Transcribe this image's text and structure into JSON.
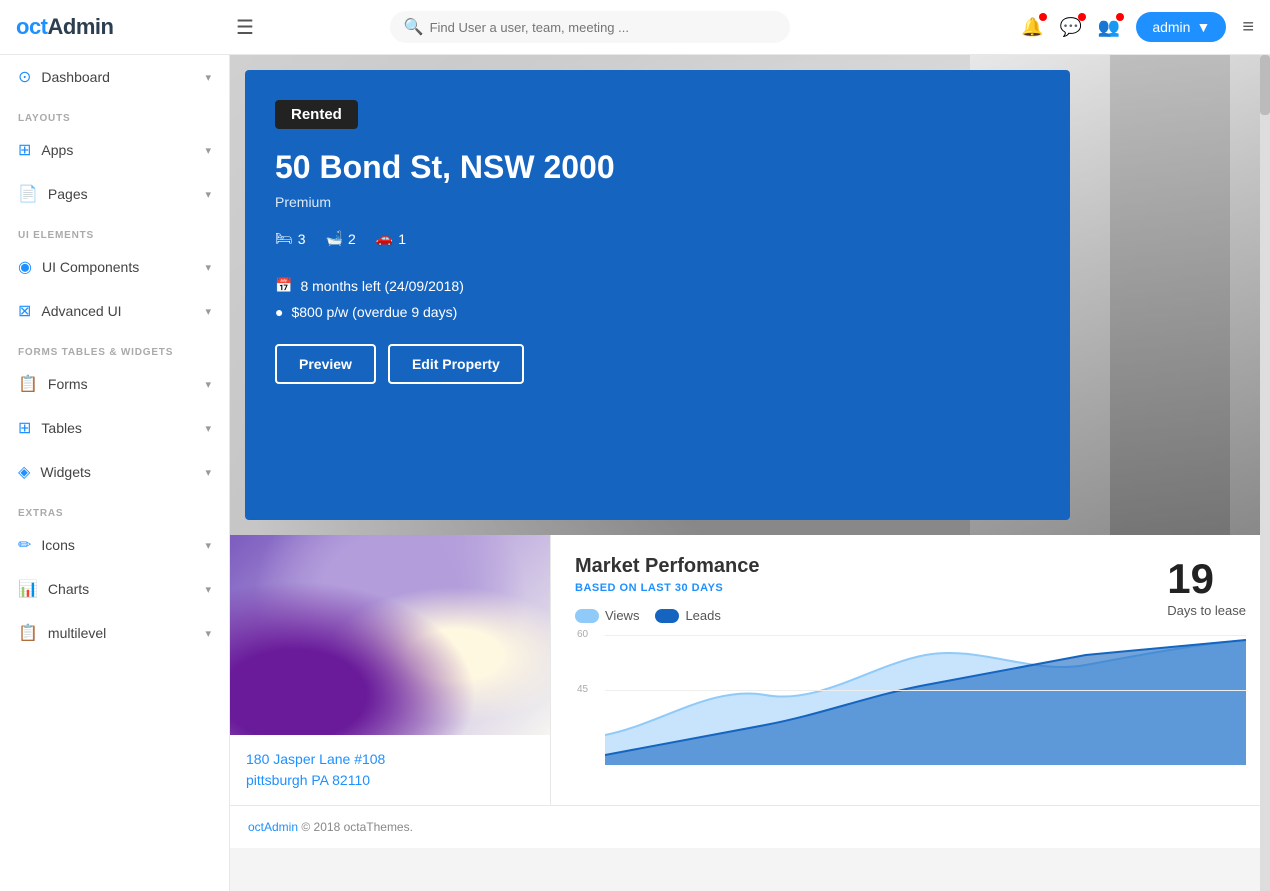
{
  "app": {
    "logo": "octAdmin",
    "logo_color": "oct",
    "logo_rest": "Admin"
  },
  "topnav": {
    "hamburger_icon": "☰",
    "search_placeholder": "Find User a user, team, meeting ...",
    "admin_label": "admin",
    "menu_icon": "≡"
  },
  "sidebar": {
    "items": [
      {
        "id": "dashboard",
        "label": "Dashboard",
        "icon": "⊙",
        "has_arrow": true
      },
      {
        "id": "apps",
        "label": "Apps",
        "icon": "⊞",
        "has_arrow": true
      },
      {
        "id": "pages",
        "label": "Pages",
        "icon": "📄",
        "has_arrow": true
      },
      {
        "id": "ui-components",
        "label": "UI Components",
        "icon": "◉",
        "has_arrow": true
      },
      {
        "id": "advanced-ui",
        "label": "Advanced UI",
        "icon": "⊠",
        "has_arrow": true
      },
      {
        "id": "forms",
        "label": "Forms",
        "icon": "📋",
        "has_arrow": true
      },
      {
        "id": "tables",
        "label": "Tables",
        "icon": "⊞",
        "has_arrow": true
      },
      {
        "id": "widgets",
        "label": "Widgets",
        "icon": "◈",
        "has_arrow": true
      },
      {
        "id": "icons",
        "label": "Icons",
        "icon": "✏",
        "has_arrow": true
      },
      {
        "id": "charts",
        "label": "Charts",
        "icon": "📊",
        "has_arrow": true
      },
      {
        "id": "multilevel",
        "label": "multilevel",
        "icon": "📋",
        "has_arrow": true
      }
    ],
    "sections": {
      "layouts": "LAYOUTS",
      "ui_elements": "UI ELEMENTS",
      "forms_tables": "FORMS TABLES & WIDGETS",
      "extras": "EXTRAS"
    }
  },
  "hero": {
    "status_badge": "Rented",
    "address": "50 Bond St, NSW 2000",
    "tier": "Premium",
    "beds": "3",
    "baths": "2",
    "cars": "1",
    "months_left": "8 months left (24/09/2018)",
    "price": "$800 p/w (overdue 9 days)",
    "btn_preview": "Preview",
    "btn_edit": "Edit Property"
  },
  "property_card": {
    "address_line1": "180 Jasper Lane #108",
    "address_line2": "pittsburgh PA 82110"
  },
  "market": {
    "title": "Market Perfomance",
    "subtitle": "BASED ON LAST 30 DAYS",
    "legend_views": "Views",
    "legend_leads": "Leads",
    "days_number": "19",
    "days_label": "Days to lease",
    "chart_labels": [
      "60",
      "45"
    ],
    "chart_y_60": 60,
    "chart_y_45": 45
  },
  "footer": {
    "brand": "octAdmin",
    "text": "© 2018 octaThemes."
  }
}
